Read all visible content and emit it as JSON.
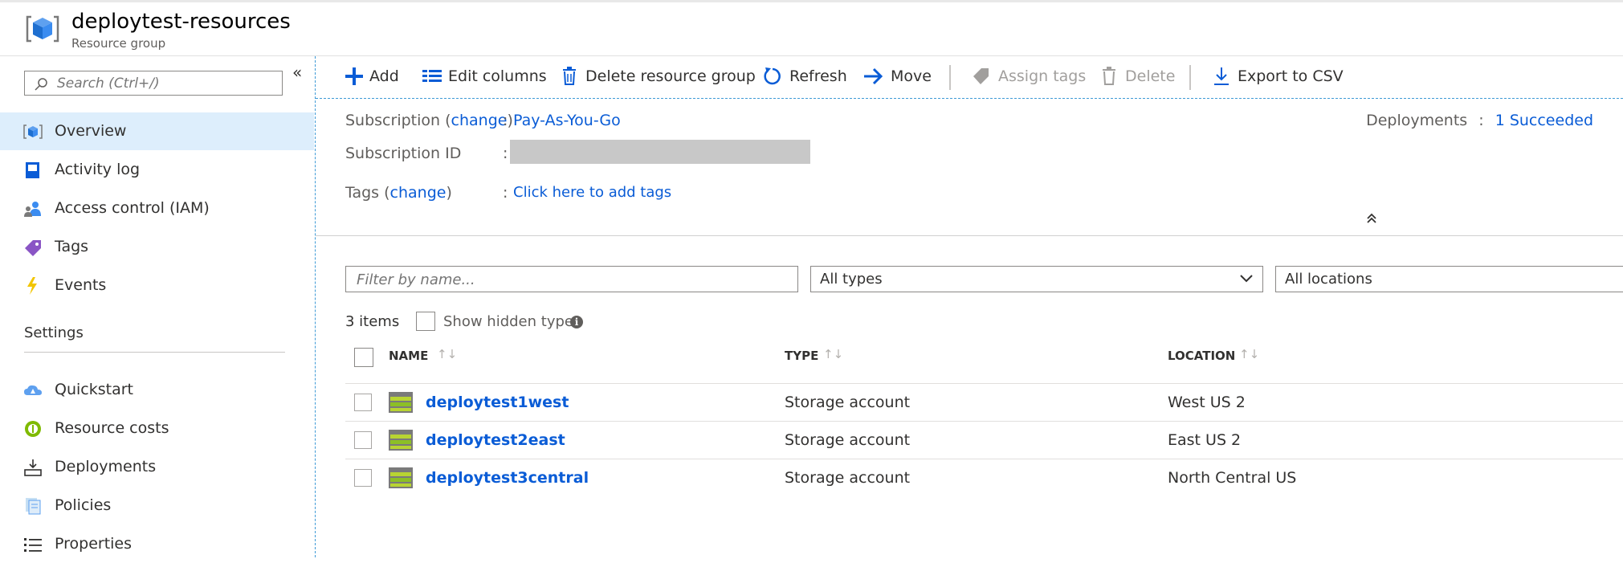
{
  "header": {
    "title": "deploytest-resources",
    "subtitle": "Resource group"
  },
  "sidebar": {
    "search_placeholder": "Search (Ctrl+/)",
    "collapse_glyph": "«",
    "items": [
      {
        "label": "Overview",
        "icon": "resource-group-cube-icon",
        "active": true
      },
      {
        "label": "Activity log",
        "icon": "activity-log-icon"
      },
      {
        "label": "Access control (IAM)",
        "icon": "access-control-icon"
      },
      {
        "label": "Tags",
        "icon": "tag-icon"
      },
      {
        "label": "Events",
        "icon": "lightning-icon"
      }
    ],
    "section_title": "Settings",
    "settings_items": [
      {
        "label": "Quickstart",
        "icon": "quickstart-cloud-icon"
      },
      {
        "label": "Resource costs",
        "icon": "resource-costs-icon"
      },
      {
        "label": "Deployments",
        "icon": "deployments-icon"
      },
      {
        "label": "Policies",
        "icon": "policies-icon"
      },
      {
        "label": "Properties",
        "icon": "properties-list-icon"
      }
    ]
  },
  "toolbar": {
    "add": "Add",
    "edit_columns": "Edit columns",
    "delete_group": "Delete resource group",
    "refresh": "Refresh",
    "move": "Move",
    "assign_tags": "Assign tags",
    "delete": "Delete",
    "export_csv": "Export to CSV"
  },
  "essentials": {
    "subscription_label": "Subscription",
    "change": "change",
    "subscription_value": "Pay-As-You-Go",
    "subscription_id_label": "Subscription ID",
    "tags_label": "Tags",
    "tags_value": "Click here to add tags",
    "colon": ":",
    "deployments_label": "Deployments",
    "deployments_value": "1 Succeeded"
  },
  "filters": {
    "name_placeholder": "Filter by name...",
    "types": "All types",
    "locations": "All locations"
  },
  "list": {
    "count": "3 items",
    "show_hidden": "Show hidden types",
    "columns": {
      "name": "NAME",
      "type": "TYPE",
      "location": "LOCATION"
    },
    "sort_glyph": "↑↓",
    "rows": [
      {
        "name": "deploytest1west",
        "type": "Storage account",
        "location": "West US 2"
      },
      {
        "name": "deploytest2east",
        "type": "Storage account",
        "location": "East US 2"
      },
      {
        "name": "deploytest3central",
        "type": "Storage account",
        "location": "North Central US"
      }
    ]
  },
  "colors": {
    "link": "#0a5cd6",
    "active_bg": "#ddeefc",
    "accent": "#0078d4"
  }
}
